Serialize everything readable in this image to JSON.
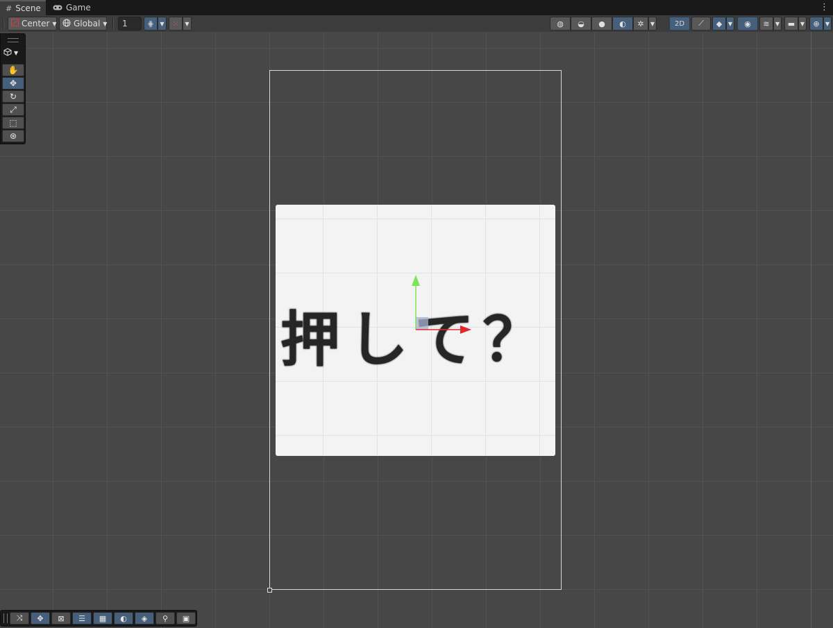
{
  "tabs": [
    {
      "label": "Scene",
      "icon": "grid-icon",
      "active": true
    },
    {
      "label": "Game",
      "icon": "gamepad-icon",
      "active": false
    }
  ],
  "toolbar": {
    "pivot_mode": "Center",
    "pivot_rotation": "Global",
    "grid_size": "1",
    "mode_2d_label": "2D"
  },
  "scene": {
    "ui_text": "押して？"
  },
  "colors": {
    "accent": "#46607c",
    "background": "#474747",
    "gizmo_x": "#e0282c",
    "gizmo_y": "#7fe25a"
  }
}
